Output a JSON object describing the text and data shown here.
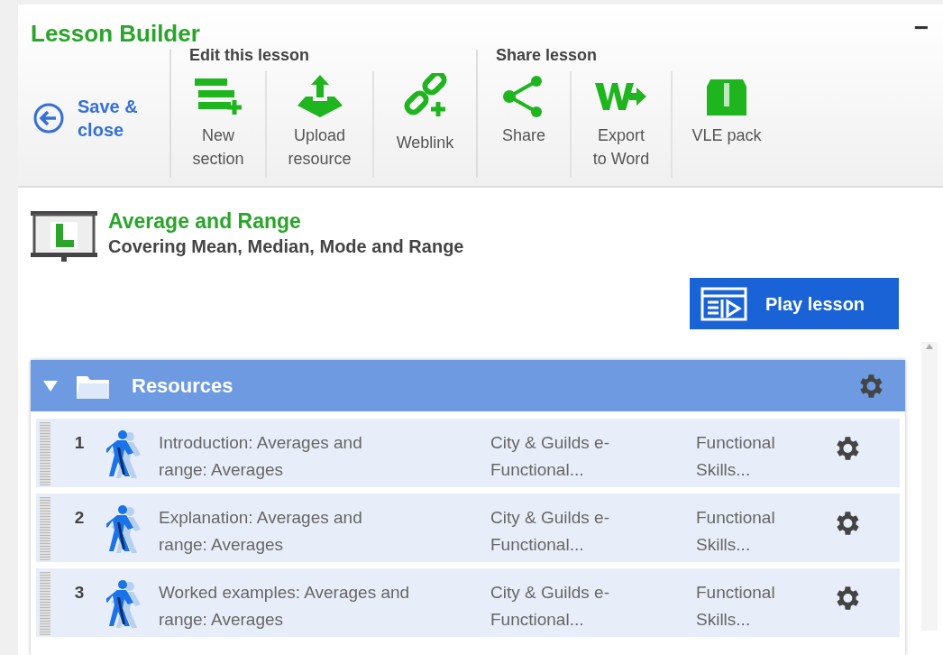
{
  "panel": {
    "title": "Lesson Builder",
    "collapse_button": "−"
  },
  "toolbar": {
    "back": "Save &\nclose",
    "groups": [
      {
        "label": "Edit this lesson",
        "items": [
          "New\nsection",
          "Upload\nresource",
          "Weblink"
        ]
      },
      {
        "label": "Share lesson",
        "items": [
          "Share",
          "Export\nto Word",
          "VLE pack"
        ]
      }
    ]
  },
  "lesson": {
    "title": "Average and Range",
    "subtitle": "Covering Mean, Median, Mode and Range",
    "play_button": "Play lesson"
  },
  "section": {
    "title": "Resources",
    "expanded": true,
    "rows": [
      {
        "number": "1",
        "title": "Introduction: Averages and\nrange: Averages",
        "provider": "City & Guilds e-\nFunctional...",
        "subject": "Functional\nSkills..."
      },
      {
        "number": "2",
        "title": "Explanation: Averages and\nrange: Averages",
        "provider": "City & Guilds e-\nFunctional...",
        "subject": "Functional\nSkills..."
      },
      {
        "number": "3",
        "title": "Worked examples: Averages and\nrange: Averages",
        "provider": "City & Guilds e-\nFunctional...",
        "subject": "Functional\nSkills..."
      }
    ]
  }
}
